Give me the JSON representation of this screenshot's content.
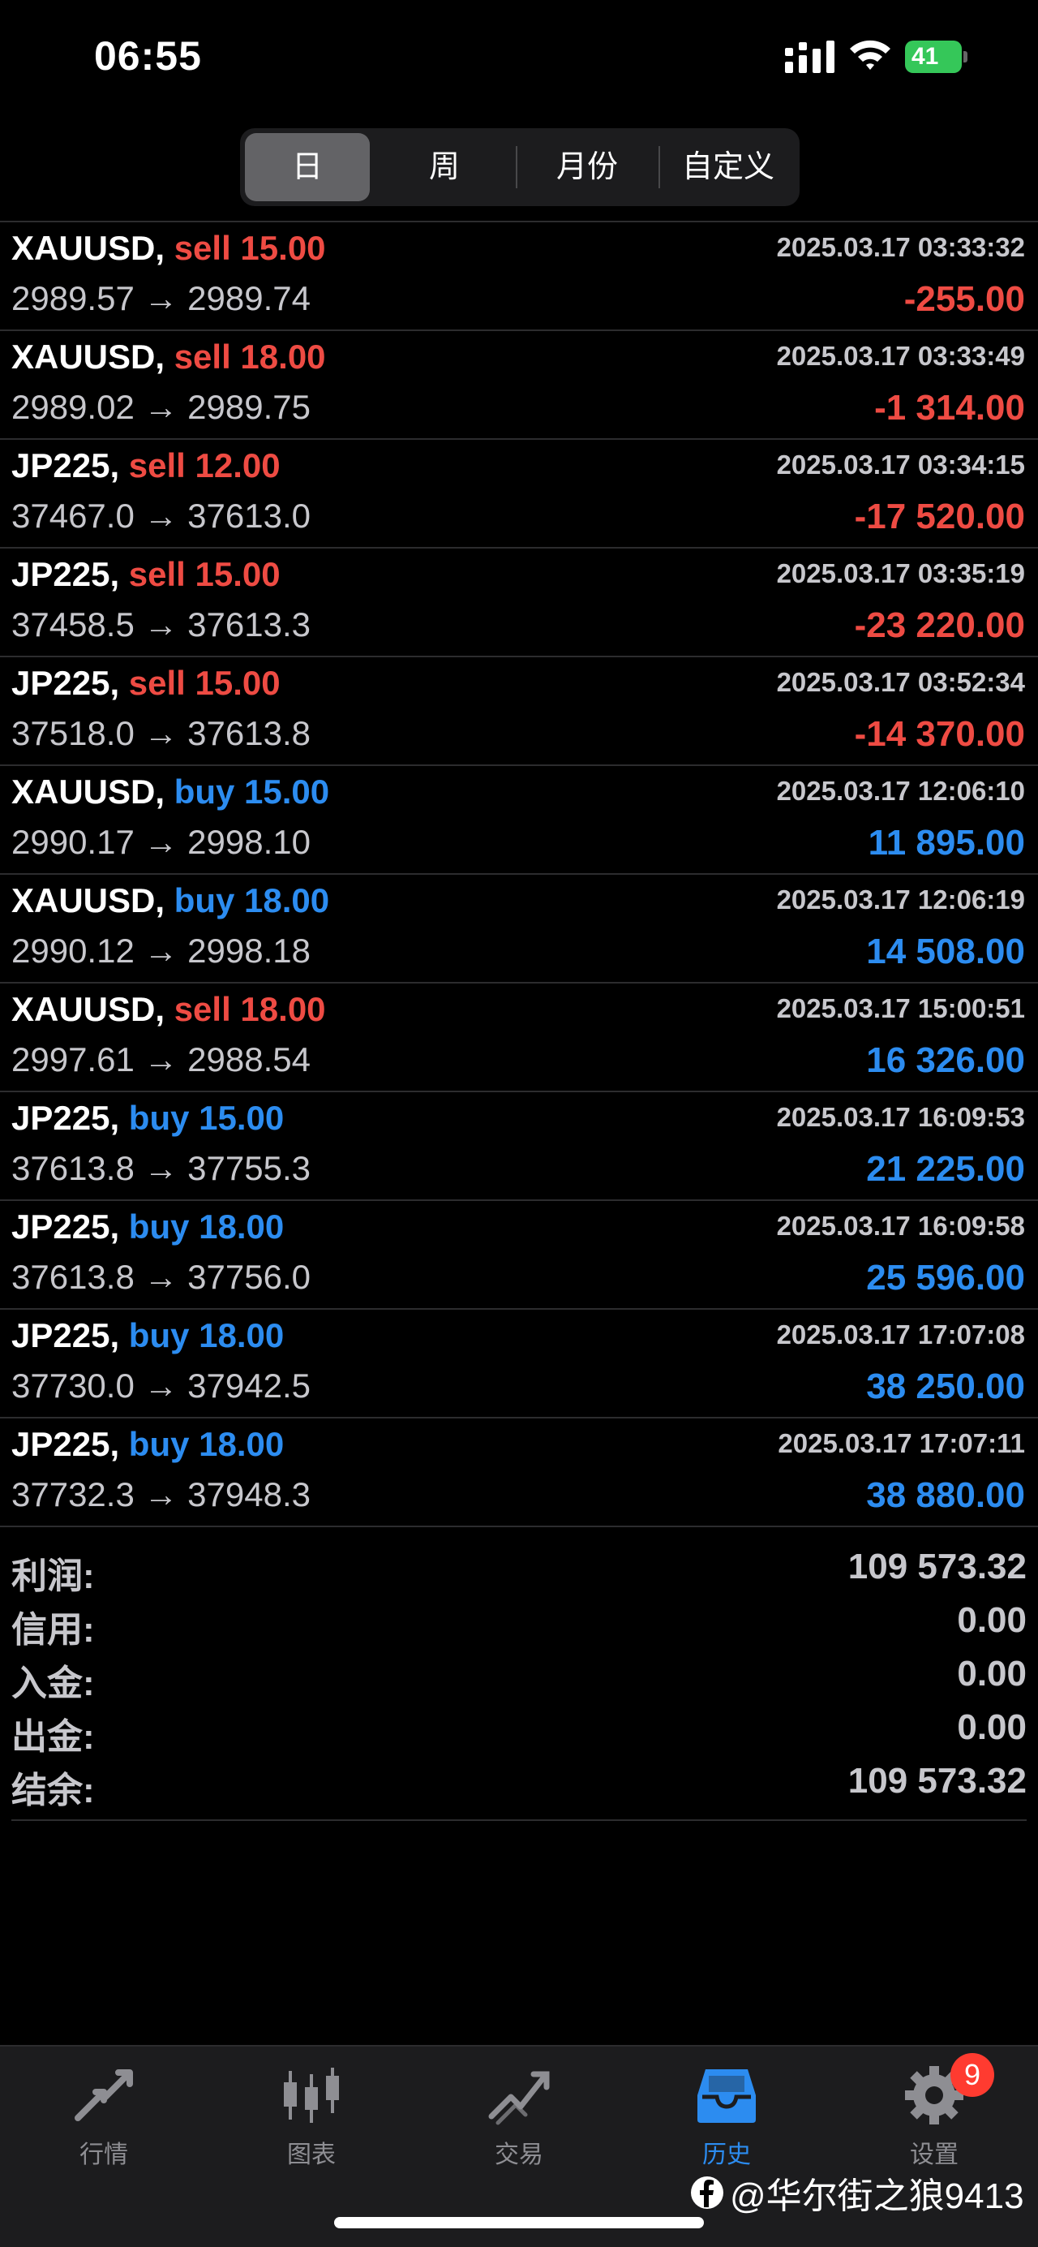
{
  "status_bar": {
    "time": "06:55",
    "battery": "41"
  },
  "period_tabs": [
    {
      "label": "日",
      "active": true
    },
    {
      "label": "周",
      "active": false
    },
    {
      "label": "月份",
      "active": false
    },
    {
      "label": "自定义",
      "active": false
    }
  ],
  "deals": [
    {
      "symbol": "XAUUSD,",
      "side": "sell 15.00",
      "time": "2025.03.17 03:33:32",
      "prices": "2989.57 → 2989.74",
      "profit": "-255.00"
    },
    {
      "symbol": "XAUUSD,",
      "side": "sell 18.00",
      "time": "2025.03.17 03:33:49",
      "prices": "2989.02 → 2989.75",
      "profit": "-1 314.00"
    },
    {
      "symbol": "JP225,",
      "side": "sell 12.00",
      "time": "2025.03.17 03:34:15",
      "prices": "37467.0 → 37613.0",
      "profit": "-17 520.00"
    },
    {
      "symbol": "JP225,",
      "side": "sell 15.00",
      "time": "2025.03.17 03:35:19",
      "prices": "37458.5 → 37613.3",
      "profit": "-23 220.00"
    },
    {
      "symbol": "JP225,",
      "side": "sell 15.00",
      "time": "2025.03.17 03:52:34",
      "prices": "37518.0 → 37613.8",
      "profit": "-14 370.00"
    },
    {
      "symbol": "XAUUSD,",
      "side": "buy 15.00",
      "time": "2025.03.17 12:06:10",
      "prices": "2990.17 → 2998.10",
      "profit": "11 895.00"
    },
    {
      "symbol": "XAUUSD,",
      "side": "buy 18.00",
      "time": "2025.03.17 12:06:19",
      "prices": "2990.12 → 2998.18",
      "profit": "14 508.00"
    },
    {
      "symbol": "XAUUSD,",
      "side": "sell 18.00",
      "time": "2025.03.17 15:00:51",
      "prices": "2997.61 → 2988.54",
      "profit": "16 326.00"
    },
    {
      "symbol": "JP225,",
      "side": "buy 15.00",
      "time": "2025.03.17 16:09:53",
      "prices": "37613.8 → 37755.3",
      "profit": "21 225.00"
    },
    {
      "symbol": "JP225,",
      "side": "buy 18.00",
      "time": "2025.03.17 16:09:58",
      "prices": "37613.8 → 37756.0",
      "profit": "25 596.00"
    },
    {
      "symbol": "JP225,",
      "side": "buy 18.00",
      "time": "2025.03.17 17:07:08",
      "prices": "37730.0 → 37942.5",
      "profit": "38 250.00"
    },
    {
      "symbol": "JP225,",
      "side": "buy 18.00",
      "time": "2025.03.17 17:07:11",
      "prices": "37732.3 → 37948.3",
      "profit": "38 880.00"
    }
  ],
  "summary": [
    {
      "label": "利润:",
      "value": "109 573.32"
    },
    {
      "label": "信用:",
      "value": "0.00"
    },
    {
      "label": "入金:",
      "value": "0.00"
    },
    {
      "label": "出金:",
      "value": "0.00"
    },
    {
      "label": "结余:",
      "value": "109 573.32"
    }
  ],
  "tab_bar": [
    {
      "label": "行情",
      "icon": "quotes-icon",
      "active": false
    },
    {
      "label": "图表",
      "icon": "candlestick-chart-icon",
      "active": false
    },
    {
      "label": "交易",
      "icon": "trade-icon",
      "active": false
    },
    {
      "label": "历史",
      "icon": "history-inbox-icon",
      "active": true
    },
    {
      "label": "设置",
      "icon": "gear-icon",
      "active": false
    }
  ],
  "settings_badge": "9",
  "watermark": "@华尔街之狼9413",
  "colors": {
    "sell": "#ee4b43",
    "buy": "#2c8cf0",
    "active": "#2c8cf0",
    "inactive": "#8e8e93"
  }
}
